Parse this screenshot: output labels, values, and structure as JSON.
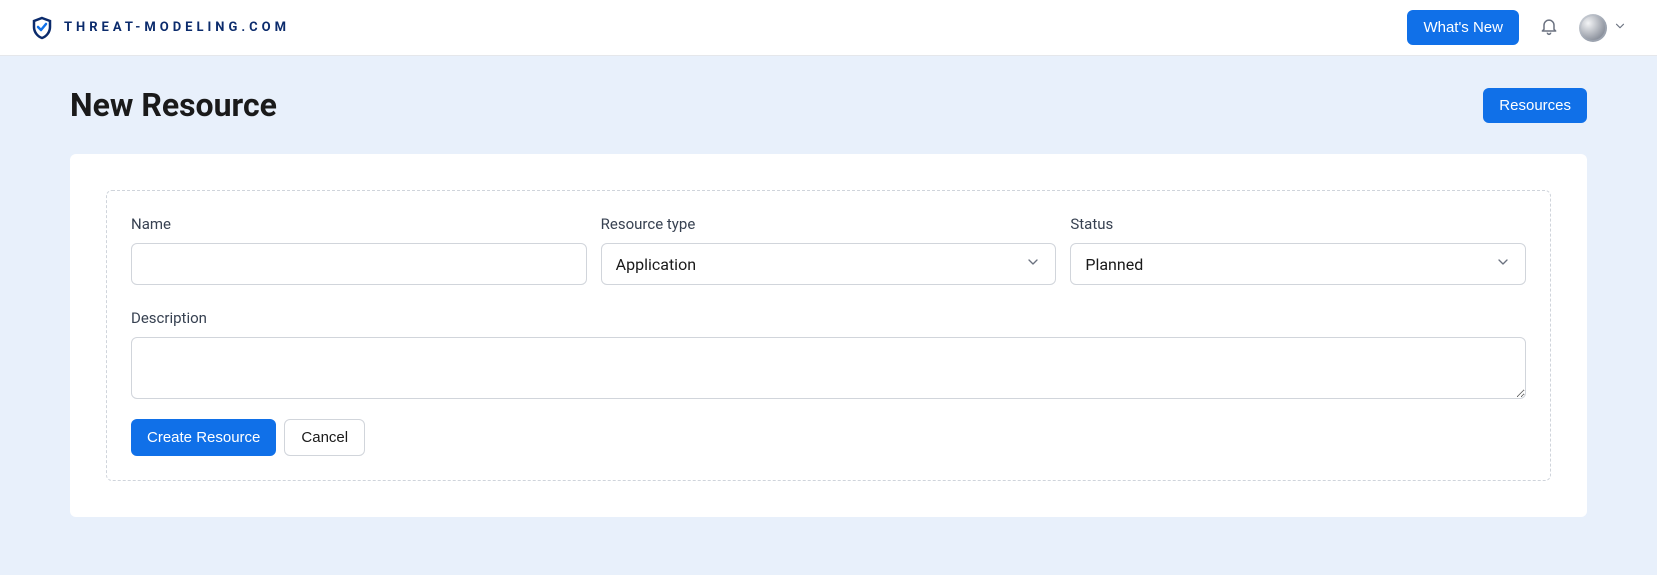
{
  "header": {
    "brand_text": "THREAT-MODELING.COM",
    "whats_new_label": "What's New"
  },
  "page": {
    "title": "New Resource",
    "resources_button": "Resources"
  },
  "form": {
    "name_label": "Name",
    "name_value": "",
    "resource_type_label": "Resource type",
    "resource_type_value": "Application",
    "status_label": "Status",
    "status_value": "Planned",
    "description_label": "Description",
    "description_value": "",
    "create_button": "Create Resource",
    "cancel_button": "Cancel"
  }
}
